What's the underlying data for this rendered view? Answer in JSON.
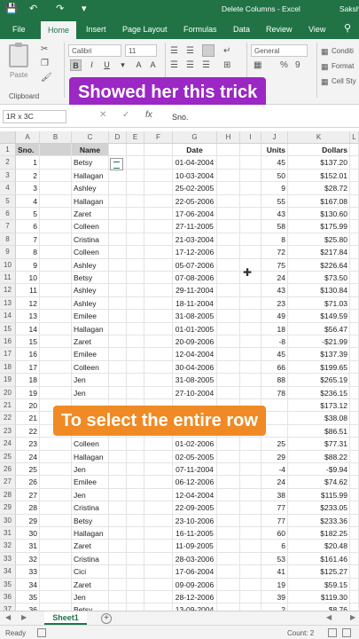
{
  "titlebar": {
    "title": "Delete Columns  -  Excel",
    "user": "Saksh",
    "icons": [
      "save-icon",
      "undo-icon",
      "redo-icon",
      "customize-icon"
    ]
  },
  "tabs": [
    "File",
    "Home",
    "Insert",
    "Page Layout",
    "Formulas",
    "Data",
    "Review",
    "View"
  ],
  "ribbon": {
    "paste_label": "Paste",
    "clipboard_label": "Clipboard",
    "font_name": "Calibri",
    "font_size": "11",
    "number_format": "General",
    "percent": "%",
    "comma": "9",
    "conditional": "Conditi",
    "format_as": "Format",
    "cell_styles": "Cell Sty"
  },
  "banner_top": "Showed her this trick",
  "banner_bottom": "To select the entire row",
  "formula_bar": {
    "name_box": "1R x 3C",
    "fx": "fx",
    "content": "Sno."
  },
  "columns": [
    "A",
    "B",
    "C",
    "D",
    "E",
    "F",
    "G",
    "H",
    "I",
    "J",
    "K"
  ],
  "headers": {
    "sno": "Sno.",
    "name": "Name",
    "date": "Date",
    "units": "Units",
    "dollars": "Dollars"
  },
  "rows": [
    {
      "r": "2",
      "sno": "1",
      "name": "Betsy",
      "date": "01-04-2004",
      "units": "45",
      "dollars": "$137.20"
    },
    {
      "r": "3",
      "sno": "2",
      "name": "Hallagan",
      "date": "10-03-2004",
      "units": "50",
      "dollars": "$152.01"
    },
    {
      "r": "4",
      "sno": "3",
      "name": "Ashley",
      "date": "25-02-2005",
      "units": "9",
      "dollars": "$28.72"
    },
    {
      "r": "5",
      "sno": "4",
      "name": "Hallagan",
      "date": "22-05-2006",
      "units": "55",
      "dollars": "$167.08"
    },
    {
      "r": "6",
      "sno": "5",
      "name": "Zaret",
      "date": "17-06-2004",
      "units": "43",
      "dollars": "$130.60"
    },
    {
      "r": "7",
      "sno": "6",
      "name": "Colleen",
      "date": "27-11-2005",
      "units": "58",
      "dollars": "$175.99"
    },
    {
      "r": "8",
      "sno": "7",
      "name": "Cristina",
      "date": "21-03-2004",
      "units": "8",
      "dollars": "$25.80"
    },
    {
      "r": "9",
      "sno": "8",
      "name": "Colleen",
      "date": "17-12-2006",
      "units": "72",
      "dollars": "$217.84"
    },
    {
      "r": "10",
      "sno": "9",
      "name": "Ashley",
      "date": "05-07-2006",
      "units": "75",
      "dollars": "$226.64"
    },
    {
      "r": "11",
      "sno": "10",
      "name": "Betsy",
      "date": "07-08-2006",
      "units": "24",
      "dollars": "$73.50"
    },
    {
      "r": "12",
      "sno": "11",
      "name": "Ashley",
      "date": "29-11-2004",
      "units": "43",
      "dollars": "$130.84"
    },
    {
      "r": "13",
      "sno": "12",
      "name": "Ashley",
      "date": "18-11-2004",
      "units": "23",
      "dollars": "$71.03"
    },
    {
      "r": "14",
      "sno": "13",
      "name": "Emilee",
      "date": "31-08-2005",
      "units": "49",
      "dollars": "$149.59"
    },
    {
      "r": "15",
      "sno": "14",
      "name": "Hallagan",
      "date": "01-01-2005",
      "units": "18",
      "dollars": "$56.47"
    },
    {
      "r": "16",
      "sno": "15",
      "name": "Zaret",
      "date": "20-09-2006",
      "units": "-8",
      "dollars": "-$21.99"
    },
    {
      "r": "17",
      "sno": "16",
      "name": "Emilee",
      "date": "12-04-2004",
      "units": "45",
      "dollars": "$137.39"
    },
    {
      "r": "18",
      "sno": "17",
      "name": "Colleen",
      "date": "30-04-2006",
      "units": "66",
      "dollars": "$199.65"
    },
    {
      "r": "19",
      "sno": "18",
      "name": "Jen",
      "date": "31-08-2005",
      "units": "88",
      "dollars": "$265.19"
    },
    {
      "r": "20",
      "sno": "19",
      "name": "Jen",
      "date": "27-10-2004",
      "units": "78",
      "dollars": "$236.15"
    },
    {
      "r": "21",
      "sno": "20",
      "name": "",
      "date": "",
      "units": "",
      "dollars": "$173.12"
    },
    {
      "r": "22",
      "sno": "21",
      "name": "",
      "date": "",
      "units": "",
      "dollars": "$38.08"
    },
    {
      "r": "23",
      "sno": "22",
      "name": "",
      "date": "",
      "units": "",
      "dollars": "$86.51"
    },
    {
      "r": "24",
      "sno": "23",
      "name": "Colleen",
      "date": "01-02-2006",
      "units": "25",
      "dollars": "$77.31"
    },
    {
      "r": "25",
      "sno": "24",
      "name": "Hallagan",
      "date": "02-05-2005",
      "units": "29",
      "dollars": "$88.22"
    },
    {
      "r": "26",
      "sno": "25",
      "name": "Jen",
      "date": "07-11-2004",
      "units": "-4",
      "dollars": "-$9.94"
    },
    {
      "r": "27",
      "sno": "26",
      "name": "Emilee",
      "date": "06-12-2006",
      "units": "24",
      "dollars": "$74.62"
    },
    {
      "r": "28",
      "sno": "27",
      "name": "Jen",
      "date": "12-04-2004",
      "units": "38",
      "dollars": "$115.99"
    },
    {
      "r": "29",
      "sno": "28",
      "name": "Cristina",
      "date": "22-09-2005",
      "units": "77",
      "dollars": "$233.05"
    },
    {
      "r": "30",
      "sno": "29",
      "name": "Betsy",
      "date": "23-10-2006",
      "units": "77",
      "dollars": "$233.36"
    },
    {
      "r": "31",
      "sno": "30",
      "name": "Hallagan",
      "date": "16-11-2005",
      "units": "60",
      "dollars": "$182.25"
    },
    {
      "r": "32",
      "sno": "31",
      "name": "Zaret",
      "date": "11-09-2005",
      "units": "6",
      "dollars": "$20.48"
    },
    {
      "r": "33",
      "sno": "32",
      "name": "Cristina",
      "date": "28-03-2006",
      "units": "53",
      "dollars": "$161.46"
    },
    {
      "r": "34",
      "sno": "33",
      "name": "Cici",
      "date": "17-06-2004",
      "units": "41",
      "dollars": "$125.27"
    },
    {
      "r": "35",
      "sno": "34",
      "name": "Zaret",
      "date": "09-09-2006",
      "units": "19",
      "dollars": "$59.15"
    },
    {
      "r": "36",
      "sno": "35",
      "name": "Jen",
      "date": "28-12-2006",
      "units": "39",
      "dollars": "$119.30"
    },
    {
      "r": "37",
      "sno": "36",
      "name": "Betsy",
      "date": "13-09-2004",
      "units": "2",
      "dollars": "$8.76"
    }
  ],
  "sheet_tab": "Sheet1",
  "add_sheet": "+",
  "status": {
    "ready": "Ready",
    "count": "Count: 2"
  },
  "colors": {
    "brand": "#217346",
    "banner_purple": "#9b27c4",
    "banner_orange": "#f08a24",
    "selection": "#d2d2d2"
  }
}
